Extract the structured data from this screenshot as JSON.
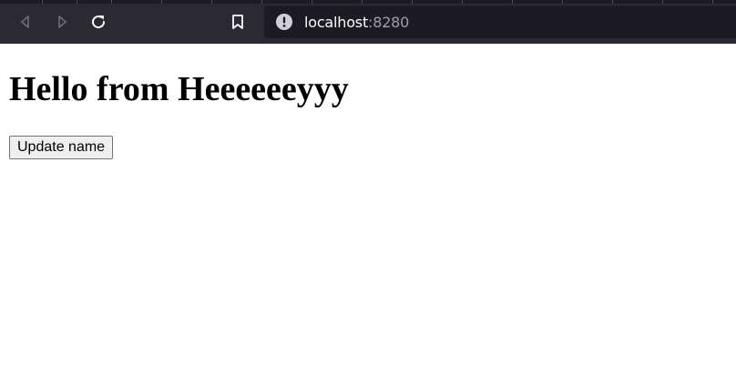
{
  "browser": {
    "address_bar": {
      "host": "localhost",
      "port": ":8280"
    },
    "icons": {
      "back": "back-arrow-icon",
      "forward": "forward-arrow-icon",
      "reload": "reload-icon",
      "bookmark": "bookmark-icon",
      "site_info": "info-warning-icon"
    }
  },
  "page": {
    "heading": "Hello from Heeeeeeyyy",
    "update_button_label": "Update name"
  }
}
